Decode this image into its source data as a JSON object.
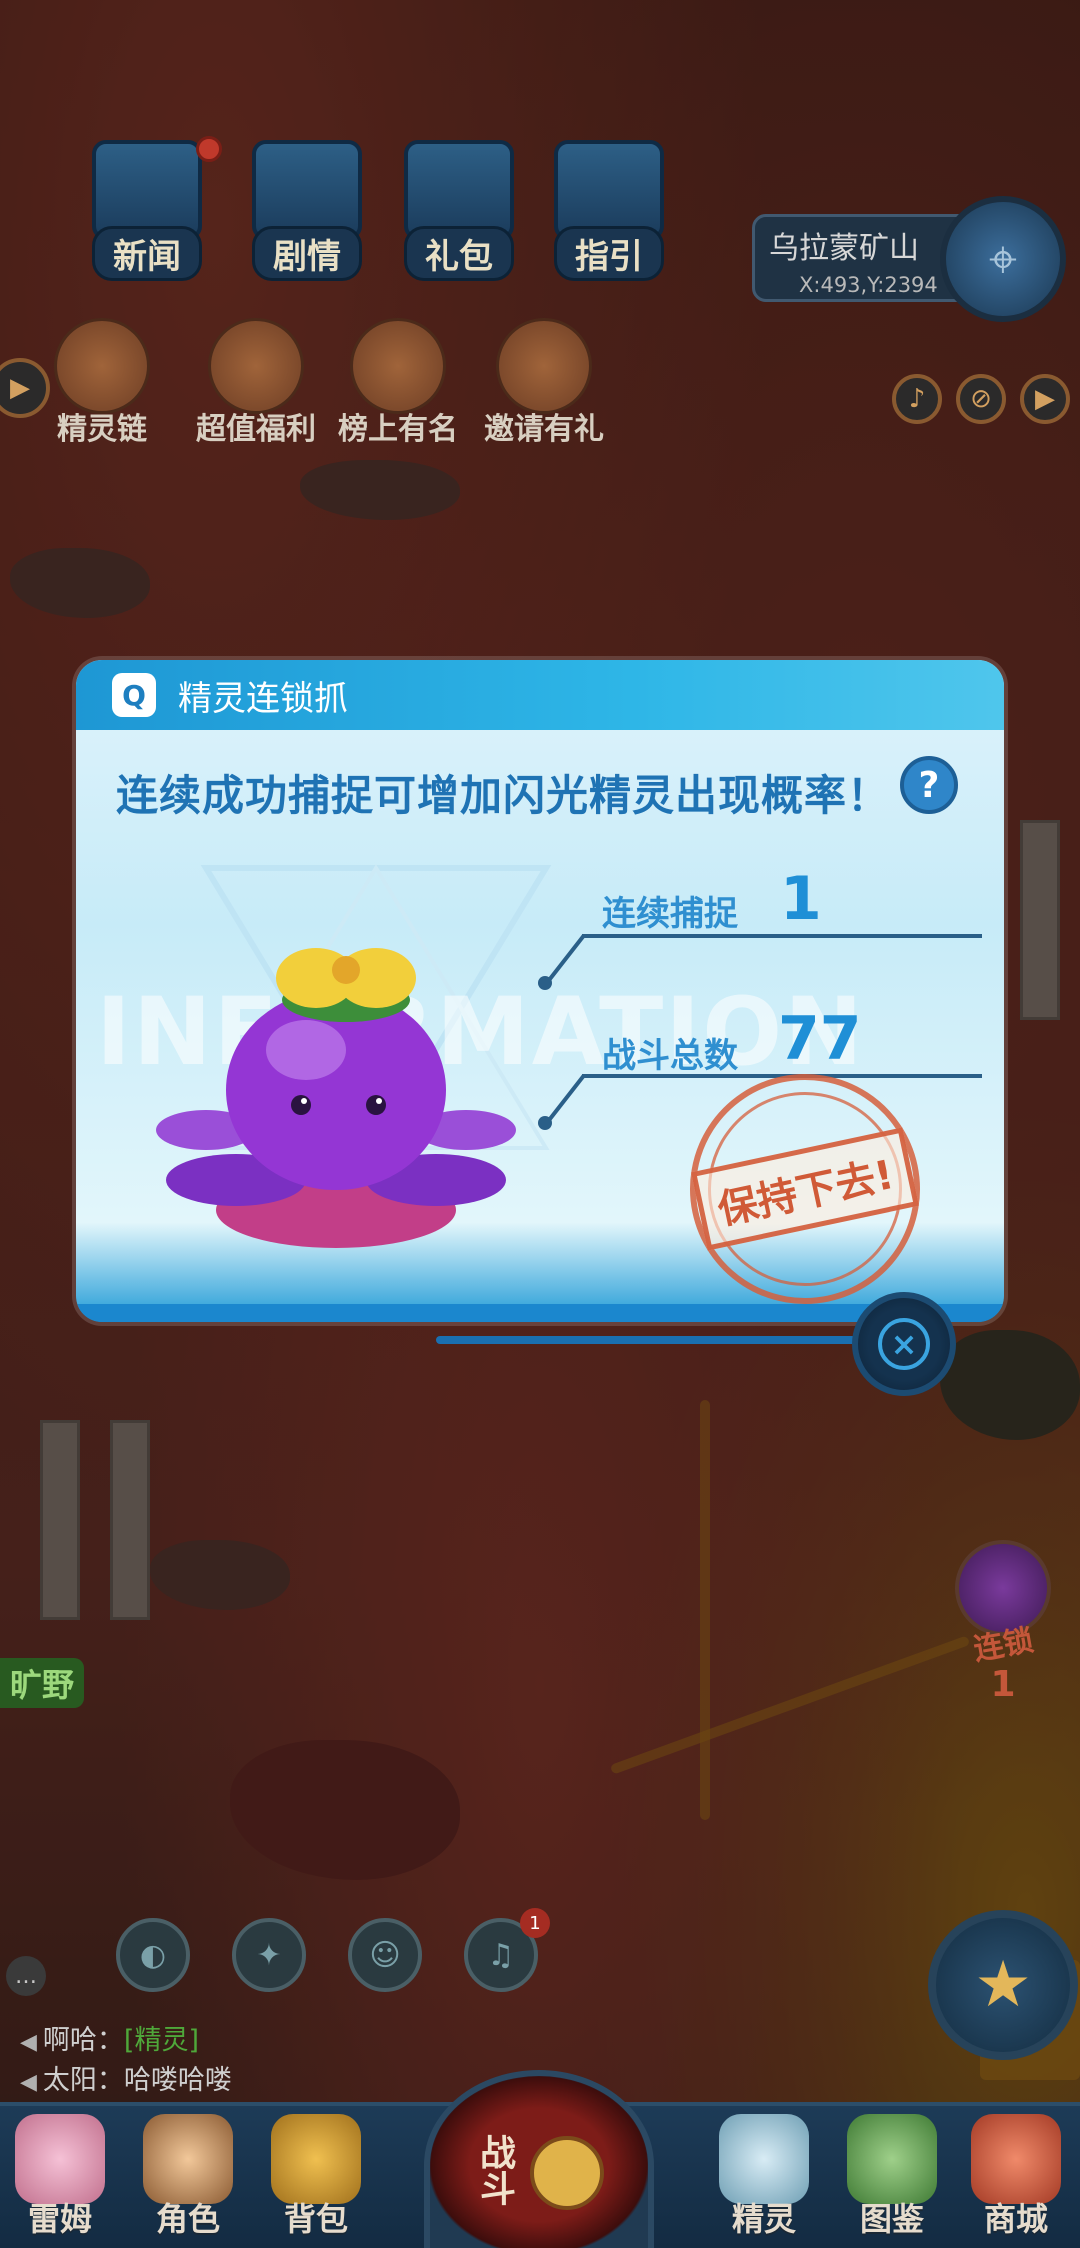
{
  "top_icons": [
    {
      "label": "新闻",
      "has_dot": true
    },
    {
      "label": "剧情",
      "has_dot": false
    },
    {
      "label": "礼包",
      "has_dot": false
    },
    {
      "label": "指引",
      "has_dot": false
    }
  ],
  "activities": [
    {
      "label": "精灵链"
    },
    {
      "label": "超值福利"
    },
    {
      "label": "榜上有名"
    },
    {
      "label": "邀请有礼"
    }
  ],
  "location": {
    "name": "乌拉蒙矿山",
    "coord": "X:493,Y:2394"
  },
  "modal": {
    "title": "精灵连锁抓",
    "heading": "连续成功捕捉可增加闪光精灵出现概率！",
    "watermark": "INFORMATION",
    "stats": [
      {
        "label": "连续捕捉",
        "value": "1"
      },
      {
        "label": "战斗总数",
        "value": "77"
      }
    ],
    "stamp": "保持下去!",
    "help_symbol": "?",
    "close_symbol": "×"
  },
  "chain_badge": {
    "label": "连锁",
    "count": "1"
  },
  "area_tag": "旷野",
  "skill_badge_count": "1",
  "chat": [
    {
      "speaker": "啊哈：",
      "text": "[精灵]",
      "is_tag": true
    },
    {
      "speaker": "太阳：",
      "text": "哈喽哈喽",
      "is_tag": false
    }
  ],
  "nav": {
    "items": [
      "雷姆",
      "角色",
      "背包",
      "精灵",
      "图鉴",
      "商城"
    ],
    "battle_label": "战斗"
  },
  "colors": {
    "accent": "#1f8fd6",
    "stamp": "#d05a37",
    "header": "#2eb6e7"
  }
}
